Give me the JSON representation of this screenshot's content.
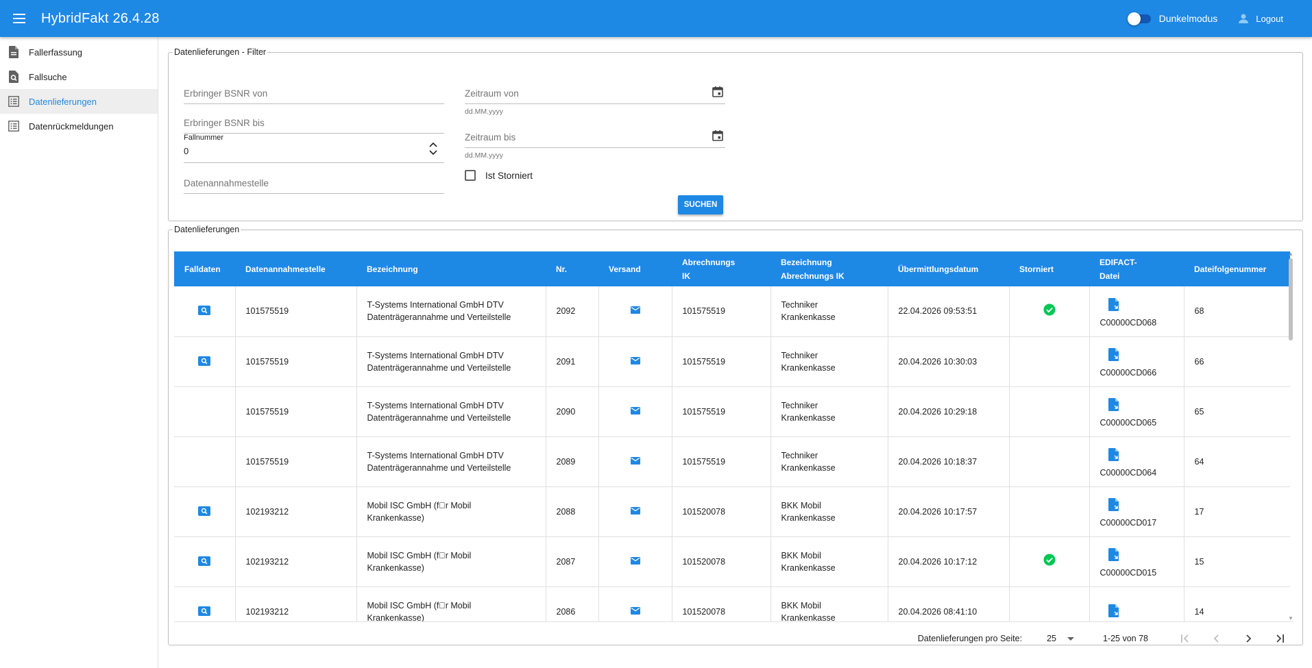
{
  "app": {
    "title": "HybridFakt 26.4.28",
    "dark_mode_label": "Dunkelmodus",
    "logout_label": "Logout",
    "colors": {
      "primary": "#1e88e5",
      "success": "#00c853"
    }
  },
  "sidebar": {
    "items": [
      {
        "label": "Fallerfassung",
        "icon": "document-icon"
      },
      {
        "label": "Fallsuche",
        "icon": "search-document-icon"
      },
      {
        "label": "Datenlieferungen",
        "icon": "list-icon",
        "active": true
      },
      {
        "label": "Datenrückmeldungen",
        "icon": "list-icon"
      }
    ]
  },
  "filter": {
    "legend": "Datenlieferungen - Filter",
    "bsnr_von": "Erbringer BSNR von",
    "bsnr_bis": "Erbringer BSNR bis",
    "fallnummer_label": "Fallnummer",
    "fallnummer_value": "0",
    "datenannahmestelle": "Datenannahmestelle",
    "zeitraum_von": "Zeitraum von",
    "zeitraum_bis": "Zeitraum bis",
    "date_hint": "dd.MM.yyyy",
    "ist_storniert": "Ist Storniert",
    "search_button": "SUCHEN"
  },
  "table": {
    "legend": "Datenlieferungen",
    "headers": {
      "falldaten": "Falldaten",
      "datenannahmestelle": "Datenannahmestelle",
      "bezeichnung": "Bezeichnung",
      "nr": "Nr.",
      "versand": "Versand",
      "abrechnungs_ik_1": "Abrechnungs",
      "abrechnungs_ik_2": "IK",
      "bez_abrechnungs_ik_1": "Bezeichnung",
      "bez_abrechnungs_ik_2": "Abrechnungs IK",
      "uebermittlungsdatum": "Übermittlungsdatum",
      "storniert": "Storniert",
      "edifact_1": "EDIFACT-",
      "edifact_2": "Datei",
      "dateifolgenummer": "Dateifolgenummer"
    },
    "rows": [
      {
        "falldaten": true,
        "dan": "101575519",
        "bez1": "T-Systems International GmbH DTV",
        "bez2": "Datenträgerannahme und Verteilstelle",
        "nr": "2092",
        "ik": "101575519",
        "bik1": "Techniker",
        "bik2": "Krankenkasse",
        "datum": "22.04.2026 09:53:51",
        "storniert": true,
        "datei": "C00000CD068",
        "folge": "68"
      },
      {
        "falldaten": true,
        "dan": "101575519",
        "bez1": "T-Systems International GmbH DTV",
        "bez2": "Datenträgerannahme und Verteilstelle",
        "nr": "2091",
        "ik": "101575519",
        "bik1": "Techniker",
        "bik2": "Krankenkasse",
        "datum": "20.04.2026 10:30:03",
        "storniert": false,
        "datei": "C00000CD066",
        "folge": "66"
      },
      {
        "falldaten": false,
        "dan": "101575519",
        "bez1": "T-Systems International GmbH DTV",
        "bez2": "Datenträgerannahme und Verteilstelle",
        "nr": "2090",
        "ik": "101575519",
        "bik1": "Techniker",
        "bik2": "Krankenkasse",
        "datum": "20.04.2026 10:29:18",
        "storniert": false,
        "datei": "C00000CD065",
        "folge": "65"
      },
      {
        "falldaten": false,
        "dan": "101575519",
        "bez1": "T-Systems International GmbH DTV",
        "bez2": "Datenträgerannahme und Verteilstelle",
        "nr": "2089",
        "ik": "101575519",
        "bik1": "Techniker",
        "bik2": "Krankenkasse",
        "datum": "20.04.2026 10:18:37",
        "storniert": false,
        "datei": "C00000CD064",
        "folge": "64"
      },
      {
        "falldaten": true,
        "dan": "102193212",
        "bez1": "Mobil ISC GmbH (f\u0000r Mobil",
        "bez2": "Krankenkasse)",
        "nr": "2088",
        "ik": "101520078",
        "bik1": "BKK Mobil",
        "bik2": "Krankenkasse",
        "datum": "20.04.2026 10:17:57",
        "storniert": false,
        "datei": "C00000CD017",
        "folge": "17"
      },
      {
        "falldaten": true,
        "dan": "102193212",
        "bez1": "Mobil ISC GmbH (f\u0000r Mobil",
        "bez2": "Krankenkasse)",
        "nr": "2087",
        "ik": "101520078",
        "bik1": "BKK Mobil",
        "bik2": "Krankenkasse",
        "datum": "20.04.2026 10:17:12",
        "storniert": true,
        "datei": "C00000CD015",
        "folge": "15"
      },
      {
        "falldaten": true,
        "dan": "102193212",
        "bez1": "Mobil ISC GmbH (f\u0000r Mobil",
        "bez2": "Krankenkasse)",
        "nr": "2086",
        "ik": "101520078",
        "bik1": "BKK Mobil",
        "bik2": "Krankenkasse",
        "datum": "20.04.2026 08:41:10",
        "storniert": false,
        "datei": "",
        "folge": "14"
      }
    ]
  },
  "paginator": {
    "per_page_label": "Datenlieferungen pro Seite:",
    "per_page_value": "25",
    "range": "1-25 von 78"
  }
}
